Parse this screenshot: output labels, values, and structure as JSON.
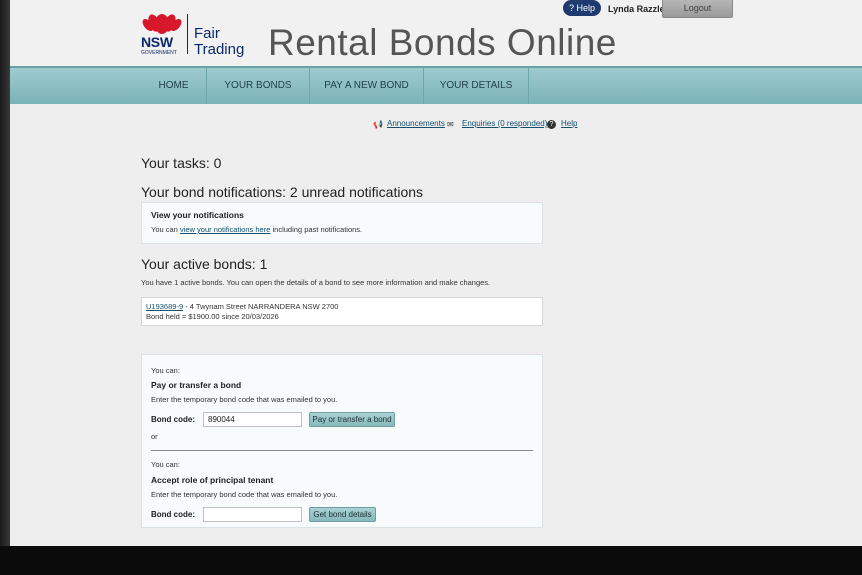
{
  "header": {
    "logo_line1": "NSW",
    "logo_line2": "GOVERNMENT",
    "brand_line1": "Fair",
    "brand_line2": "Trading",
    "site_title": "Rental Bonds Online",
    "help_label": "? Help",
    "user_name": "Lynda Razzle",
    "logout_label": "Logout"
  },
  "nav": {
    "items": [
      {
        "label": "HOME"
      },
      {
        "label": "YOUR BONDS"
      },
      {
        "label": "PAY A NEW BOND"
      },
      {
        "label": "YOUR DETAILS"
      }
    ]
  },
  "utility": {
    "announcements": "Announcements",
    "enquiries": "Enquiries (0 responded)",
    "help": "Help"
  },
  "tasks": {
    "heading": "Your tasks: 0"
  },
  "notifications": {
    "heading": "Your bond notifications: 2 unread notifications",
    "panel_title": "View your notifications",
    "text_before": "You can",
    "link": "view your notifications here",
    "text_after": "including past notifications."
  },
  "active_bonds": {
    "heading": "Your active bonds: 1",
    "summary": "You have  1  active bonds. You can open the details of a bond to see more information and make changes.",
    "bond_id": "U193689-9",
    "bond_address": " - 4 Twynam Street NARRANDERA NSW 2700",
    "bond_held": "Bond held = $1900.00 since 20/03/2026"
  },
  "actions": {
    "you_can_1": "You can:",
    "pay_title": "Pay or transfer a bond",
    "pay_instructions": "Enter the temporary bond code that was emailed to you.",
    "bond_code_label_1": "Bond code:",
    "bond_code_value": "890044",
    "pay_button": "Pay or transfer a bond",
    "or": "or",
    "you_can_2": "You can:",
    "accept_title": "Accept role of principal tenant",
    "accept_instructions": "Enter the temporary bond code that was emailed to you.",
    "bond_code_label_2": "Bond code:",
    "bond_code_value_2": "",
    "get_details_button": "Get bond details"
  },
  "colors": {
    "nav_teal": "#8fc1c5",
    "brand_navy": "#0b2a6b",
    "waratah_red": "#d7182a"
  }
}
